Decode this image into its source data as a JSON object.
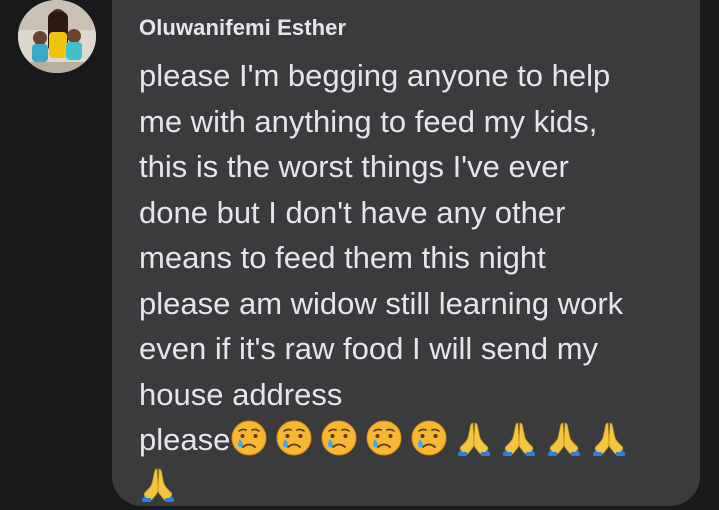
{
  "comment": {
    "author": "Oluwanifemi Esther",
    "lines": [
      "please I'm begging anyone to help",
      "me with anything to feed my kids,",
      "this is the worst things I've ever",
      "done but I don't have any other",
      "means to feed them this night",
      "please am widow still learning work",
      "even if it's raw food I will send my",
      "house address"
    ],
    "last_word": "please",
    "emojis": [
      "crying-face",
      "crying-face",
      "crying-face",
      "crying-face",
      "crying-face",
      "folded-hands",
      "folded-hands",
      "folded-hands",
      "folded-hands",
      "folded-hands"
    ]
  },
  "colors": {
    "background": "#18191a",
    "bubble": "#3a3b3c",
    "text": "#e4e6eb"
  }
}
